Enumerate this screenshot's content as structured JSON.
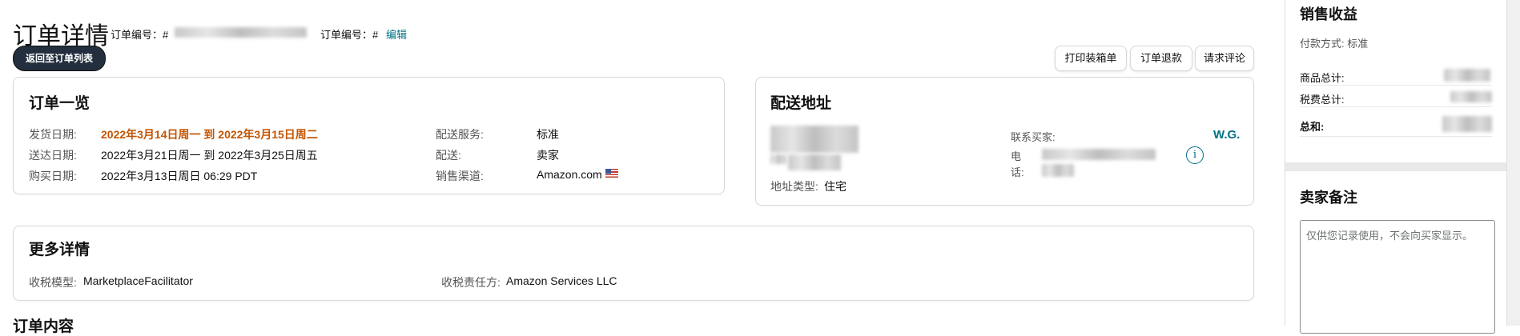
{
  "header": {
    "title": "订单详情",
    "order_no_label_1": "订单编号：#",
    "order_no_label_2": "订单编号：#",
    "edit_link": "编辑",
    "back_button": "返回至订单列表"
  },
  "actions": {
    "print_label": "打印装箱单",
    "refund_label": "订单退款",
    "review_label": "请求评论"
  },
  "order_summary": {
    "title": "订单一览",
    "ship_date_label": "发货日期:",
    "ship_date_value": "2022年3月14日周一 到 2022年3月15日周二",
    "deliver_date_label": "送达日期:",
    "deliver_date_value": "2022年3月21日周一 到 2022年3月25日周五",
    "purchase_date_label": "购买日期:",
    "purchase_date_value": "2022年3月13日周日 06:29 PDT",
    "service_label": "配送服务:",
    "service_value": "标准",
    "fulfillment_label": "配送:",
    "fulfillment_value": "卖家",
    "channel_label": "销售渠道:",
    "channel_value": "Amazon.com"
  },
  "shipping": {
    "title": "配送地址",
    "address_type_label": "地址类型:",
    "address_type_value": "住宅",
    "contact_label": "联系买家:",
    "buyer_name": "W.G.",
    "phone_label_1": "电",
    "phone_label_2": "话:",
    "info_icon": "info-icon"
  },
  "more_details": {
    "title": "更多详情",
    "tax_model_label": "收税模型:",
    "tax_model_value": "MarketplaceFacilitator",
    "tax_responsible_label": "收税责任方:",
    "tax_responsible_value": "Amazon Services LLC"
  },
  "order_content": {
    "title": "订单内容"
  },
  "sidebar": {
    "revenue_title": "销售收益",
    "payment_label": "付款方式: 标准",
    "item_total_label": "商品总计:",
    "tax_total_label": "税费总计:",
    "grand_total_label": "总和:",
    "notes_title": "卖家备注",
    "notes_placeholder": "仅供您记录使用，不会向买家显示。"
  },
  "colors": {
    "orange": "#c45500",
    "link": "#007185",
    "buyer_link": "#007185",
    "dark_button": "#232f3e"
  }
}
